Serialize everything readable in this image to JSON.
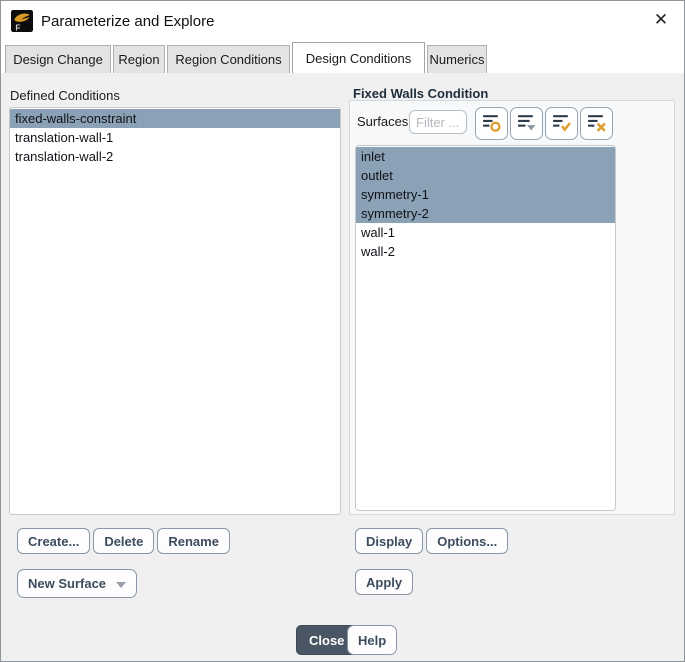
{
  "window": {
    "title": "Parameterize and Explore",
    "close_glyph": "✕"
  },
  "tabs": [
    {
      "label": "Design Change",
      "active": false
    },
    {
      "label": "Region",
      "active": false
    },
    {
      "label": "Region Conditions",
      "active": false
    },
    {
      "label": "Design Conditions",
      "active": true
    },
    {
      "label": "Numerics",
      "active": false
    }
  ],
  "left_panel": {
    "label": "Defined Conditions",
    "items": [
      {
        "label": "fixed-walls-constraint",
        "selected": true
      },
      {
        "label": "translation-wall-1",
        "selected": false
      },
      {
        "label": "translation-wall-2",
        "selected": false
      }
    ],
    "buttons": [
      "Create...",
      "Delete",
      "Rename"
    ],
    "new_surface_label": "New Surface"
  },
  "right_panel": {
    "header": "Fixed Walls Condition",
    "surfaces_label": "Surfaces",
    "filter_placeholder": "Filter ...",
    "toolbar_icons": [
      "filter-match-icon",
      "list-options-icon",
      "select-all-icon",
      "deselect-all-icon"
    ],
    "items": [
      {
        "label": "inlet",
        "selected": true
      },
      {
        "label": "outlet",
        "selected": true
      },
      {
        "label": "symmetry-1",
        "selected": true
      },
      {
        "label": "symmetry-2",
        "selected": true
      },
      {
        "label": "wall-1",
        "selected": false
      },
      {
        "label": "wall-2",
        "selected": false
      }
    ],
    "buttons": [
      "Display",
      "Options..."
    ],
    "apply_label": "Apply"
  },
  "footer": {
    "close_label": "Close",
    "help_label": "Help"
  },
  "colors": {
    "selection": "#8ba1b5",
    "accent_orange": "#dd9f2f",
    "button_text": "#3c4c5e",
    "close_button_bg": "#4a5663",
    "icon_line": "#2c3a49"
  }
}
